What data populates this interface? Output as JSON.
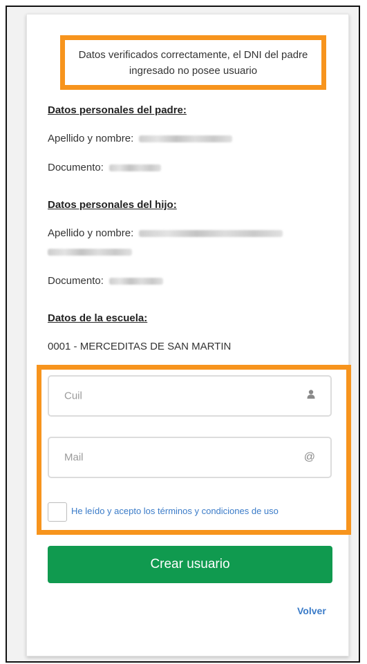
{
  "notice": {
    "text": "Datos verificados correctamente, el DNI del padre ingresado no posee usuario"
  },
  "padre": {
    "heading": "Datos personales del padre:",
    "nombre_label": "Apellido y nombre:",
    "documento_label": "Documento:"
  },
  "hijo": {
    "heading": "Datos personales del hijo:",
    "nombre_label": "Apellido y nombre:",
    "documento_label": "Documento:"
  },
  "escuela": {
    "heading": "Datos de la escuela:",
    "value": "0001 - MERCEDITAS DE SAN MARTIN"
  },
  "form": {
    "cuil_placeholder": "Cuil",
    "cuil_icon": "user-icon",
    "mail_placeholder": "Mail",
    "mail_icon": "at-icon",
    "terms_label": "He leído y acepto los términos y condiciones de uso",
    "submit_label": "Crear usuario",
    "back_label": "Volver"
  },
  "colors": {
    "highlight": "#f7941d",
    "primary_button": "#109a4f",
    "link": "#3a7bc8"
  }
}
